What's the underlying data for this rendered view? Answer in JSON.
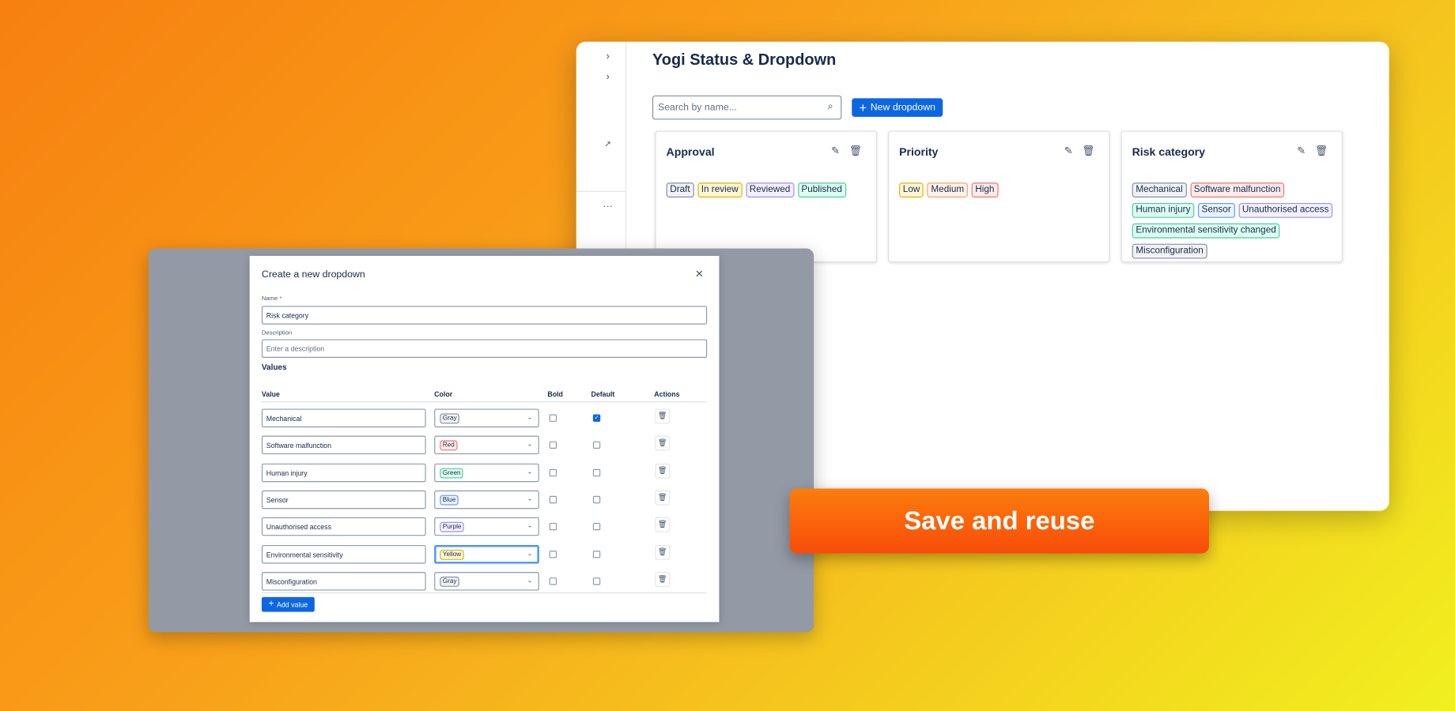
{
  "main": {
    "title": "Yogi Status & Dropdown",
    "search_placeholder": "Search by name...",
    "new_dropdown_label": "New dropdown",
    "cards": [
      {
        "title": "Approval",
        "tags": [
          {
            "label": "Draft",
            "color": "Gray"
          },
          {
            "label": "In review",
            "color": "Yellow"
          },
          {
            "label": "Reviewed",
            "color": "Purple"
          },
          {
            "label": "Published",
            "color": "Green"
          }
        ]
      },
      {
        "title": "Priority",
        "tags": [
          {
            "label": "Low",
            "color": "Yellow"
          },
          {
            "label": "Medium",
            "color": "Orange"
          },
          {
            "label": "High",
            "color": "Red"
          }
        ]
      },
      {
        "title": "Risk category",
        "tags": [
          {
            "label": "Mechanical",
            "color": "Gray"
          },
          {
            "label": "Software malfunction",
            "color": "Red"
          },
          {
            "label": "Human injury",
            "color": "Green"
          },
          {
            "label": "Sensor",
            "color": "Blue"
          },
          {
            "label": "Unauthorised access",
            "color": "Purple"
          },
          {
            "label": "Environmental sensitivity changed",
            "color": "Green"
          },
          {
            "label": "Misconfiguration",
            "color": "Gray"
          }
        ]
      }
    ]
  },
  "modal": {
    "title": "Create a new dropdown",
    "name_label": "Name",
    "required_mark": "*",
    "name_value": "Risk category",
    "description_label": "Description",
    "description_placeholder": "Enter a description",
    "values_heading": "Values",
    "headers": {
      "value": "Value",
      "color": "Color",
      "bold": "Bold",
      "default": "Default",
      "actions": "Actions"
    },
    "rows": [
      {
        "value": "Mechanical",
        "color": "Gray",
        "bold": false,
        "default": true
      },
      {
        "value": "Software malfunction",
        "color": "Red",
        "bold": false,
        "default": false
      },
      {
        "value": "Human injury",
        "color": "Green",
        "bold": false,
        "default": false
      },
      {
        "value": "Sensor",
        "color": "Blue",
        "bold": false,
        "default": false
      },
      {
        "value": "Unauthorised access",
        "color": "Purple",
        "bold": false,
        "default": false
      },
      {
        "value": "Environmental sensitivity",
        "color": "Yellow",
        "bold": false,
        "default": false,
        "focused": true
      },
      {
        "value": "Misconfiguration",
        "color": "Gray",
        "bold": false,
        "default": false
      }
    ],
    "add_value_label": "Add value"
  },
  "cta": {
    "label": "Save and reuse"
  }
}
